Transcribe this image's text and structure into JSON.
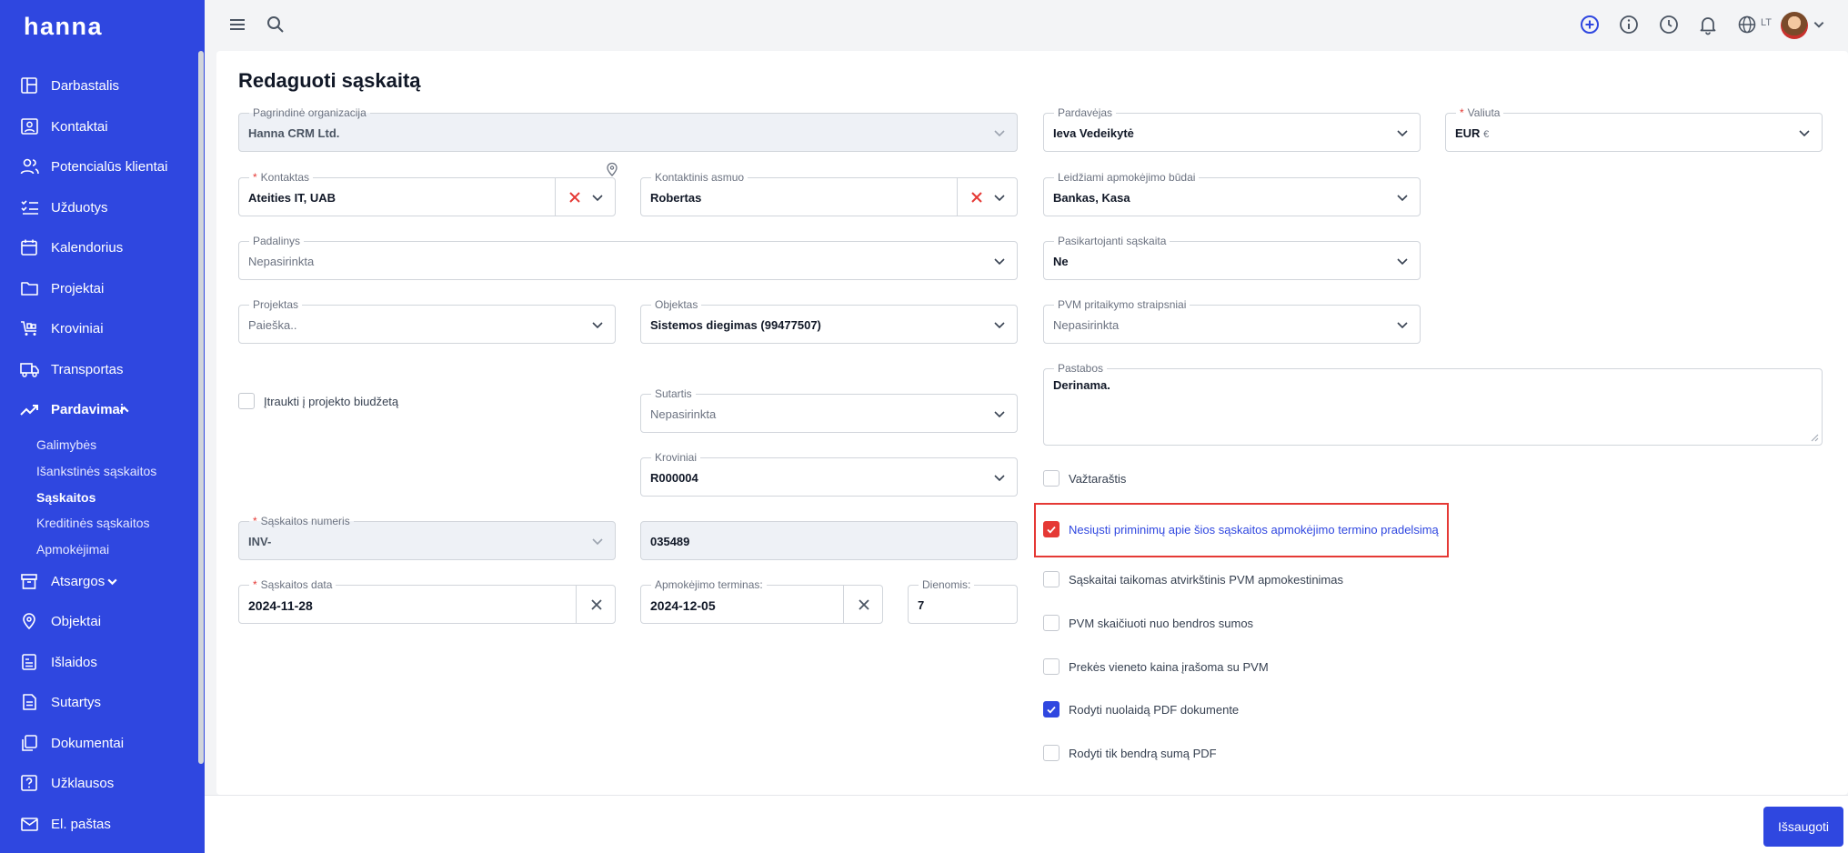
{
  "app": {
    "logo": "hanna"
  },
  "sidebar": {
    "items": [
      {
        "label": "Darbastalis",
        "icon": "dashboard-icon"
      },
      {
        "label": "Kontaktai",
        "icon": "contacts-icon"
      },
      {
        "label": "Potencialūs klientai",
        "icon": "leads-icon"
      },
      {
        "label": "Užduotys",
        "icon": "tasks-icon"
      },
      {
        "label": "Kalendorius",
        "icon": "calendar-icon"
      },
      {
        "label": "Projektai",
        "icon": "folder-icon"
      },
      {
        "label": "Kroviniai",
        "icon": "cart-icon"
      },
      {
        "label": "Transportas",
        "icon": "truck-icon"
      },
      {
        "label": "Pardavimai",
        "icon": "trending-up-icon"
      },
      {
        "label": "Atsargos",
        "icon": "box-icon"
      },
      {
        "label": "Objektai",
        "icon": "location-icon"
      },
      {
        "label": "Išlaidos",
        "icon": "expenses-icon"
      },
      {
        "label": "Sutartys",
        "icon": "contract-icon"
      },
      {
        "label": "Dokumentai",
        "icon": "documents-icon"
      },
      {
        "label": "Užklausos",
        "icon": "question-icon"
      },
      {
        "label": "El. paštas",
        "icon": "mail-icon"
      }
    ],
    "sales_sub": [
      "Galimybės",
      "Išankstinės sąskaitos",
      "Sąskaitos",
      "Kreditinės sąskaitos",
      "Apmokėjimai"
    ]
  },
  "topbar": {
    "lang": "LT"
  },
  "page": {
    "title": "Redaguoti sąskaitą"
  },
  "form": {
    "org": {
      "label": "Pagrindinė organizacija",
      "value": "Hanna CRM Ltd."
    },
    "contact": {
      "label": "Kontaktas",
      "value": "Ateities IT, UAB"
    },
    "contact_person": {
      "label": "Kontaktinis asmuo",
      "value": "Robertas"
    },
    "division": {
      "label": "Padalinys",
      "value": "Nepasirinkta"
    },
    "project": {
      "label": "Projektas",
      "value": "Paieška.."
    },
    "object": {
      "label": "Objektas",
      "value": "Sistemos diegimas (99477507)"
    },
    "include_budget": "Įtraukti į projekto biudžetą",
    "contract": {
      "label": "Sutartis",
      "value": "Nepasirinkta"
    },
    "cargo": {
      "label": "Kroviniai",
      "value": "R000004"
    },
    "invoice_series": {
      "label": "Sąskaitos numeris",
      "value": "INV-"
    },
    "invoice_number": {
      "value": "035489"
    },
    "invoice_date": {
      "label": "Sąskaitos data",
      "value": "2024-11-28"
    },
    "due_date": {
      "label": "Apmokėjimo terminas:",
      "value": "2024-12-05"
    },
    "days": {
      "label": "Dienomis:",
      "value": "7"
    },
    "seller": {
      "label": "Pardavėjas",
      "value": "Ieva Vedeikytė"
    },
    "currency": {
      "label": "Valiuta",
      "value": "EUR",
      "suffix": "€"
    },
    "payment_methods": {
      "label": "Leidžiami apmokėjimo būdai",
      "value": "Bankas, Kasa"
    },
    "recurring": {
      "label": "Pasikartojanti sąskaita",
      "value": "Ne"
    },
    "vat_articles": {
      "label": "PVM pritaikymo straipsniai",
      "value": "Nepasirinkta"
    },
    "notes": {
      "label": "Pastabos",
      "value": "Derinama."
    },
    "checks": [
      {
        "label": "Važtaraštis",
        "checked": false
      },
      {
        "label": "Nesiųsti priminimų apie šios sąskaitos apmokėjimo termino pradelsimą",
        "checked": true
      },
      {
        "label": "Sąskaitai taikomas atvirkštinis PVM apmokestinimas",
        "checked": false
      },
      {
        "label": "PVM skaičiuoti nuo bendros sumos",
        "checked": false
      },
      {
        "label": "Prekės vieneto kaina įrašoma su PVM",
        "checked": false
      },
      {
        "label": "Rodyti nuolaidą PDF dokumente",
        "checked": true
      },
      {
        "label": "Rodyti tik bendrą sumą PDF",
        "checked": false
      }
    ]
  },
  "footer": {
    "save_label": "Išsaugoti"
  },
  "colors": {
    "brand": "#2f47e0",
    "danger": "#e53935"
  }
}
